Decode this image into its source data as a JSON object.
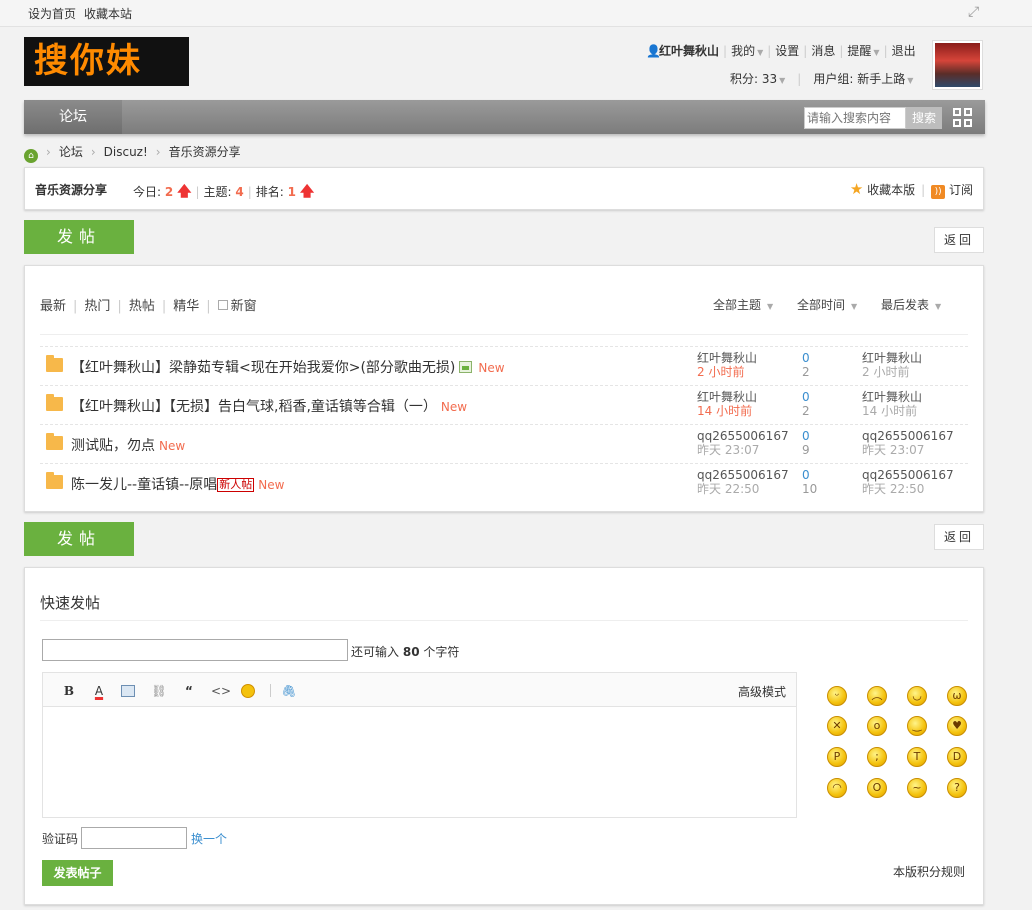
{
  "topbar": {
    "set_home": "设为首页",
    "bookmark": "收藏本站"
  },
  "logo": {
    "text": "搜你妹"
  },
  "user": {
    "name": "红叶舞秋山",
    "my": "我的",
    "settings": "设置",
    "messages": "消息",
    "reminders": "提醒",
    "logout": "退出",
    "points_label": "积分: 33",
    "group_label": "用户组: 新手上路"
  },
  "nav": {
    "forum_tab": "论坛",
    "search_placeholder": "请输入搜索内容",
    "search_button": "搜索"
  },
  "breadcrumb": [
    "论坛",
    "Discuz!",
    "音乐资源分享"
  ],
  "forum": {
    "name": "音乐资源分享",
    "today_label": "今日:",
    "today_value": "2",
    "topics_label": "主题:",
    "topics_value": "4",
    "rank_label": "排名:",
    "rank_value": "1",
    "favorite": "收藏本版",
    "subscribe": "订阅"
  },
  "buttons": {
    "post": "发帖",
    "back": "返回"
  },
  "filters": {
    "latest": "最新",
    "hot": "热门",
    "hot_threads": "热帖",
    "digest": "精华",
    "new_window": "新窗"
  },
  "sorters": {
    "all_topics": "全部主题",
    "all_time": "全部时间",
    "last_post": "最后发表"
  },
  "threads": [
    {
      "title": "【红叶舞秋山】梁静茹专辑<现在开始我爱你>(部分歌曲无损)",
      "new": "New",
      "author": "红叶舞秋山",
      "time": "2 小时前",
      "replies": "0",
      "views": "2",
      "last_user": "红叶舞秋山",
      "last_time": "2 小时前"
    },
    {
      "title": "【红叶舞秋山】【无损】告白气球,稻香,童话镇等合辑（一）",
      "new": "New",
      "author": "红叶舞秋山",
      "time": "14 小时前",
      "replies": "0",
      "views": "2",
      "last_user": "红叶舞秋山",
      "last_time": "14 小时前"
    },
    {
      "title": "测试贴，勿点",
      "new": "New",
      "author": "qq2655006167",
      "time": "昨天 23:07",
      "replies": "0",
      "views": "9",
      "last_user": "qq2655006167",
      "last_time": "昨天 23:07"
    },
    {
      "title": "陈一发儿--童话镇--原唱",
      "badge": "新人帖",
      "new": "New",
      "author": "qq2655006167",
      "time": "昨天 22:50",
      "replies": "0",
      "views": "10",
      "last_user": "qq2655006167",
      "last_time": "昨天 22:50"
    }
  ],
  "quickpost": {
    "title": "快速发帖",
    "remain_prefix": "还可输入",
    "remain_count": "80",
    "remain_suffix": "个字符",
    "advanced": "高级模式",
    "captcha_label": "验证码",
    "captcha_refresh": "换一个",
    "submit": "发表帖子",
    "rules": "本版积分规则"
  },
  "colors": {
    "accent_green": "#6ab13f",
    "highlight_red": "#f26c4f",
    "link_blue": "#3a8ecf"
  }
}
